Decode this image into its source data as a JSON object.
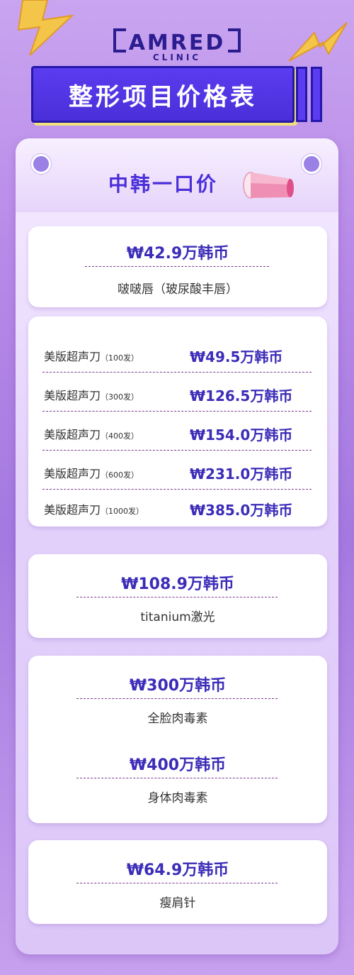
{
  "logo": {
    "name": "AMRED",
    "sub": "CLINIC"
  },
  "title": "整形项目价格表",
  "section_title": "中韩一口价",
  "items": {
    "lip": {
      "price": "₩42.9万韩币",
      "name": "啵啵唇（玻尿酸丰唇）"
    },
    "ulthera": [
      {
        "name": "美版超声刀",
        "spec": "（100发）",
        "price": "₩49.5万韩币"
      },
      {
        "name": "美版超声刀",
        "spec": "（300发）",
        "price": "₩126.5万韩币"
      },
      {
        "name": "美版超声刀",
        "spec": "（400发）",
        "price": "₩154.0万韩币"
      },
      {
        "name": "美版超声刀",
        "spec": "（600发）",
        "price": "₩231.0万韩币"
      },
      {
        "name": "美版超声刀",
        "spec": "（1000发）",
        "price": "₩385.0万韩币"
      }
    ],
    "titanium": {
      "price": "₩108.9万韩币",
      "name": "titanium激光"
    },
    "botox_face": {
      "price": "₩300万韩币",
      "name": "全脸肉毒素"
    },
    "botox_body": {
      "price": "₩400万韩币",
      "name": "身体肉毒素"
    },
    "shoulder": {
      "price": "₩64.9万韩币",
      "name": "瘦肩针"
    }
  },
  "colors": {
    "accent": "#4a2fd8",
    "price": "#3c2cb8",
    "dash": "#7a3f8c",
    "bolt": "#f3c64a"
  }
}
